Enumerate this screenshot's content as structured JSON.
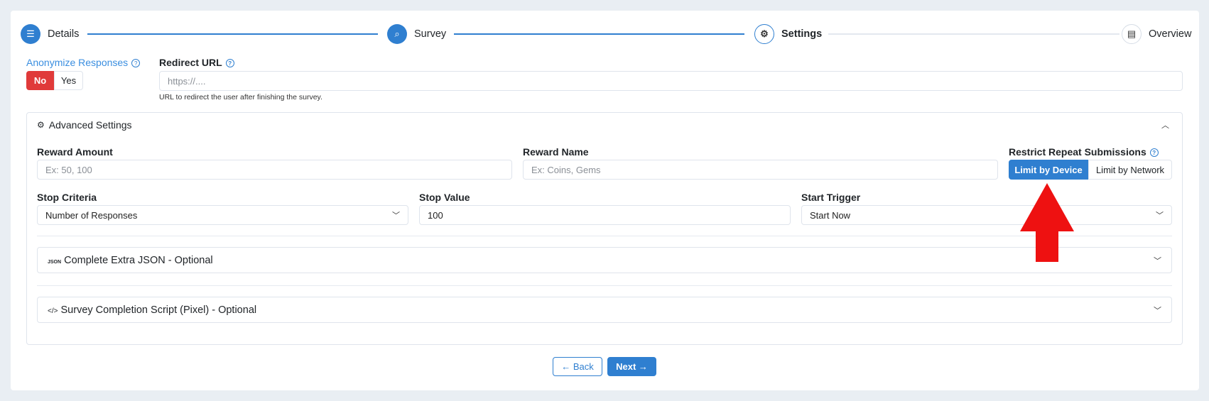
{
  "stepper": [
    {
      "label": "Details",
      "icon": "list-icon",
      "state": "done"
    },
    {
      "label": "Survey",
      "icon": "survey-search-icon",
      "state": "done"
    },
    {
      "label": "Settings",
      "icon": "gear-icon",
      "state": "current"
    },
    {
      "label": "Overview",
      "icon": "clipboard-check-icon",
      "state": "pending"
    }
  ],
  "anonymize": {
    "label": "Anonymize Responses",
    "options": [
      "No",
      "Yes"
    ],
    "selected": "No"
  },
  "redirect": {
    "label": "Redirect URL",
    "placeholder": "https://....",
    "value": "",
    "help": "URL to redirect the user after finishing the survey."
  },
  "advanced": {
    "title": "Advanced Settings",
    "reward_amount": {
      "label": "Reward Amount",
      "placeholder": "Ex: 50, 100"
    },
    "reward_name": {
      "label": "Reward Name",
      "placeholder": "Ex: Coins, Gems"
    },
    "restrict": {
      "label": "Restrict Repeat Submissions",
      "options": [
        "Limit by Device",
        "Limit by Network"
      ],
      "selected": "Limit by Device"
    },
    "stop_criteria": {
      "label": "Stop Criteria",
      "value": "Number of Responses"
    },
    "stop_value": {
      "label": "Stop Value",
      "value": "100"
    },
    "start_trigger": {
      "label": "Start Trigger",
      "value": "Start Now"
    },
    "json_section": {
      "icon_text": "JSON",
      "title": "Complete Extra JSON - Optional"
    },
    "script_section": {
      "icon_text": "</>",
      "title": "Survey Completion Script (Pixel) - Optional"
    }
  },
  "nav": {
    "back": "← Back",
    "next": "Next →"
  },
  "colors": {
    "primary": "#2f7fd0",
    "danger": "#e03a3a",
    "annotation_arrow": "#ee1111"
  }
}
